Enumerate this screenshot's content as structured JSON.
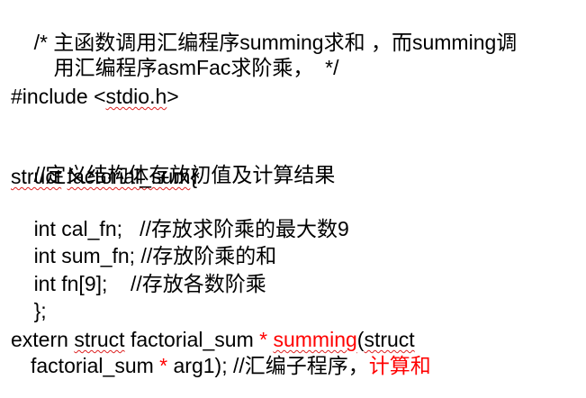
{
  "code": {
    "comment_line1": "/* 主函数调用汇编程序summing求和 ，而summing调",
    "comment_line2": "用汇编程序asmFac求阶乘，  */",
    "include_prefix": "#include <",
    "include_file": "stdio.h",
    "include_suffix": ">",
    "struct_comment": "//定义结构体存放初值及计算结果",
    "struct_kw": "struct",
    "struct_space": " ",
    "struct_name": "factorial_sum",
    "struct_brace": "{",
    "field1": "int cal_fn;   //存放求阶乘的最大数9",
    "field2": "int sum_fn; //存放阶乘的和",
    "field3": "int fn[9];    //存放各数阶乘",
    "struct_end": "};",
    "extern_kw": "extern ",
    "extern_struct": "struct",
    "extern_type": " factorial_sum ",
    "extern_star": "*",
    "extern_space": " ",
    "extern_func": "summing",
    "extern_paren": "(",
    "extern_struct2": "struct",
    "line2_type": "factorial_sum ",
    "line2_star": "*",
    "line2_arg": " arg1); //汇编子程序，",
    "line2_red": "计算和"
  },
  "colors": {
    "text": "#000000",
    "highlight": "#ff0000",
    "spellcheck": "#dd2222"
  }
}
